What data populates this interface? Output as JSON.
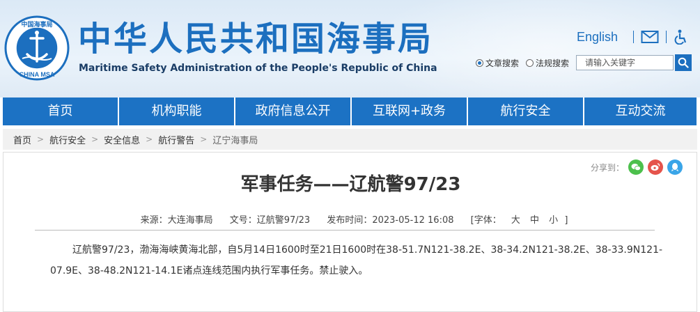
{
  "header": {
    "title_cn": "中华人民共和国海事局",
    "title_en": "Maritime Safety Administration of the People's Republic of China",
    "logo_text_top": "中国海事局",
    "logo_text_bottom": "CHINA MSA",
    "english_link": "English",
    "icons": [
      "mail-icon",
      "accessibility-icon"
    ]
  },
  "search": {
    "options": [
      {
        "label": "文章搜索",
        "selected": true
      },
      {
        "label": "法规搜索",
        "selected": false
      }
    ],
    "placeholder": "请输入关键字"
  },
  "nav": {
    "items": [
      "首页",
      "机构职能",
      "政府信息公开",
      "互联网+政务",
      "航行安全",
      "互动交流"
    ]
  },
  "breadcrumb": [
    "首页",
    "航行安全",
    "安全信息",
    "航行警告",
    "辽宁海事局"
  ],
  "share": {
    "label": "分享到：",
    "icons": [
      "wechat-icon",
      "weibo-icon",
      "qq-icon"
    ]
  },
  "article": {
    "title": "军事任务——辽航警97/23",
    "source": "来源：大连海事局",
    "doc_no": "文号：辽航警97/23",
    "published": "发布时间：2023-05-12 16:08",
    "font_label": "[字体：",
    "font_sizes": [
      "大",
      "中",
      "小"
    ],
    "font_close": "]",
    "body": "辽航警97/23，渤海海峡黄海北部，自5月14日1600时至21日1600时在38-51.7N121-38.2E、38-34.2N121-38.2E、38-33.9N121-07.9E、38-48.2N121-14.1E诸点连线范围内执行军事任务。禁止驶入。"
  },
  "colors": {
    "brand_blue": "#1c72c4",
    "title_blue": "#1c6fbf",
    "wechat": "#4cc04c",
    "weibo": "#e5534b",
    "qq": "#3aa5e8"
  }
}
